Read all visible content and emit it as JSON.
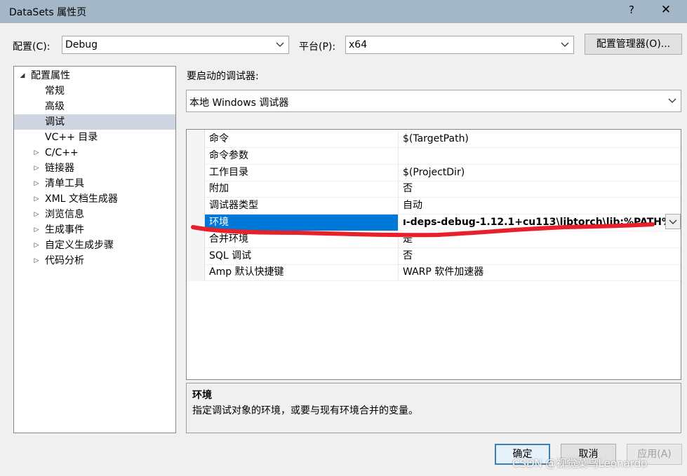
{
  "window": {
    "title": "DataSets 属性页",
    "help": "?",
    "close": "✕"
  },
  "config": {
    "label": "配置(C):",
    "value": "Debug"
  },
  "platform": {
    "label": "平台(P):",
    "value": "x64"
  },
  "config_manager_label": "配置管理器(O)...",
  "tree": {
    "root": "配置属性",
    "items": [
      {
        "label": "常规",
        "expandable": false
      },
      {
        "label": "高级",
        "expandable": false
      },
      {
        "label": "调试",
        "expandable": false,
        "selected": true
      },
      {
        "label": "VC++ 目录",
        "expandable": false
      },
      {
        "label": "C/C++",
        "expandable": true
      },
      {
        "label": "链接器",
        "expandable": true
      },
      {
        "label": "清单工具",
        "expandable": true
      },
      {
        "label": "XML 文档生成器",
        "expandable": true
      },
      {
        "label": "浏览信息",
        "expandable": true
      },
      {
        "label": "生成事件",
        "expandable": true
      },
      {
        "label": "自定义生成步骤",
        "expandable": true
      },
      {
        "label": "代码分析",
        "expandable": true
      }
    ]
  },
  "debugger": {
    "label": "要启动的调试器:",
    "value": "本地 Windows 调试器"
  },
  "properties": [
    {
      "name": "命令",
      "value": "$(TargetPath)"
    },
    {
      "name": "命令参数",
      "value": ""
    },
    {
      "name": "工作目录",
      "value": "$(ProjectDir)"
    },
    {
      "name": "附加",
      "value": "否"
    },
    {
      "name": "调试器类型",
      "value": "自动"
    },
    {
      "name": "环境",
      "value": "ı-deps-debug-1.12.1+cu113\\libtorch\\lib;%PATH%",
      "selected": true
    },
    {
      "name": "合并环境",
      "value": "是"
    },
    {
      "name": "SQL 调试",
      "value": "否"
    },
    {
      "name": "Amp 默认快捷键",
      "value": "WARP 软件加速器"
    }
  ],
  "description": {
    "title": "环境",
    "text": "指定调试对象的环境，或要与现有环境合并的变量。"
  },
  "buttons": {
    "ok": "确定",
    "cancel": "取消",
    "apply": "应用(A)"
  },
  "watermark": "CSDN @视觉菜鸟Leonardo",
  "colors": {
    "selection": "#0078d7",
    "annotation": "#e8202a",
    "titlebar": "#a3b7c9"
  }
}
